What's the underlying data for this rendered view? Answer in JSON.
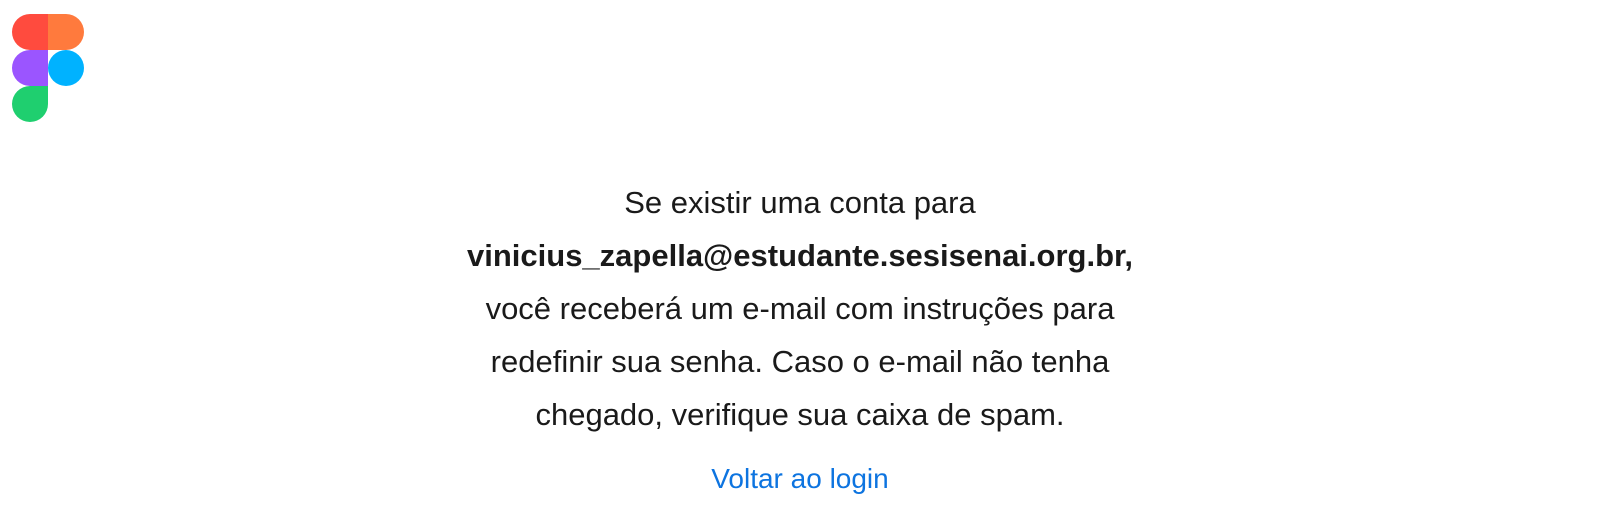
{
  "brand": {
    "logo_icon": "figma-logo-icon",
    "colors": {
      "red": "#f24e1e",
      "orange": "#ff7262",
      "purple": "#a259ff",
      "blue": "#1abcfe",
      "green": "#0acf83"
    }
  },
  "message": {
    "line1": "Se existir uma conta para",
    "email": "vinicius_zapella@estudante.sesisenai.org.br",
    "email_suffix": ",",
    "line3": "você receberá um e-mail com instruções para",
    "line4": "redefinir sua senha. Caso o e-mail não tenha",
    "line5": "chegado, verifique sua caixa de spam."
  },
  "back_link": {
    "label": "Voltar ao login",
    "color": "#0d74e0"
  }
}
